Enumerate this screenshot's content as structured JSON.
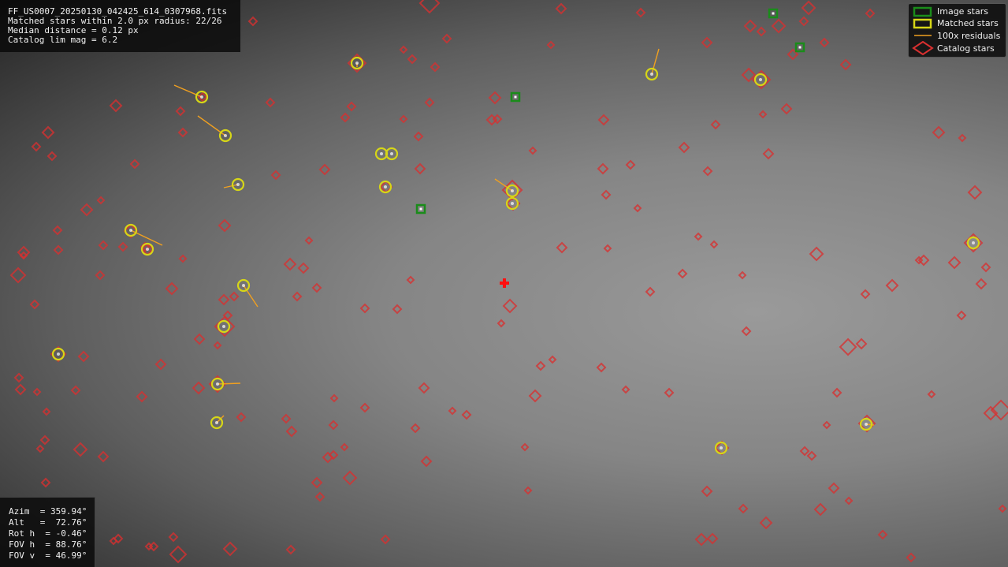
{
  "info": {
    "filename": "FF_US0007_20250130_042425_614_0307968.fits",
    "matched": "Matched stars within 2.0 px radius: 22/26",
    "median": "Median distance = 0.12 px",
    "limmag": "Catalog lim mag = 6.2"
  },
  "pointing": {
    "azim": "Azim  = 359.94°",
    "alt": "Alt   =  72.76°",
    "roth": "Rot h  = -0.46°",
    "fovh": "FOV h  = 88.76°",
    "fovv": "FOV v  = 46.99°"
  },
  "legend": {
    "image_stars": "Image stars",
    "matched_stars": "Matched stars",
    "residuals": "100x residuals",
    "catalog_stars": "Catalog stars"
  },
  "colors": {
    "image_star": "#1a8c1a",
    "matched_star": "#d6d617",
    "residual": "#f0a020",
    "catalog_star": "#d93030",
    "center_marker": "#ff1010"
  }
}
